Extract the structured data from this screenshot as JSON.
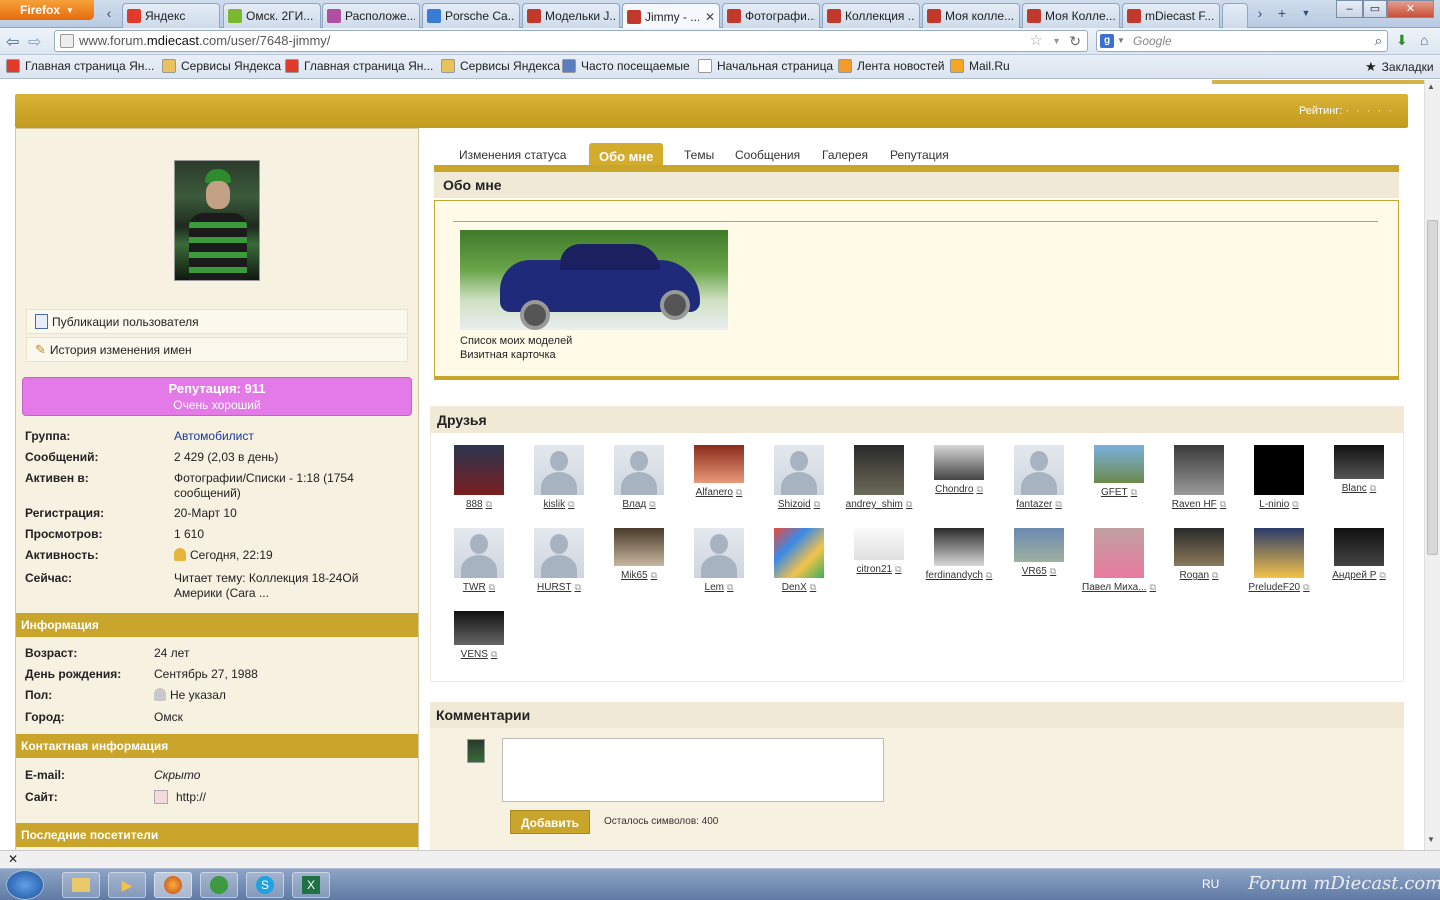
{
  "browser": {
    "menu_button": "Firefox",
    "tabs": [
      {
        "label": "Яндекс",
        "color": "#e23a2a"
      },
      {
        "label": "Омск. 2ГИ...",
        "color": "#7ab82f"
      },
      {
        "label": "Расположе...",
        "color": "#b04fa1"
      },
      {
        "label": "Porsche Ca...",
        "color": "#3a7bd5"
      },
      {
        "label": "Модельки J...",
        "color": "#c0392b"
      },
      {
        "label": "Jimmy - ...",
        "color": "#c0392b"
      },
      {
        "label": "Фотографи...",
        "color": "#c0392b"
      },
      {
        "label": "Коллекция ...",
        "color": "#c0392b"
      },
      {
        "label": "Моя колле...",
        "color": "#c0392b"
      },
      {
        "label": "Моя Колле...",
        "color": "#c0392b"
      },
      {
        "label": "mDiecast F...",
        "color": "#c0392b"
      }
    ],
    "active_tab_close": "✕",
    "url_prefix": "www.forum.",
    "url_domain": "mdiecast",
    "url_suffix": ".com/user/7648-jimmy/",
    "search_placeholder": "Google",
    "bookmarks": [
      {
        "label": "Главная страница Ян...",
        "icon": "yandex-icon"
      },
      {
        "label": "Сервисы Яндекса",
        "icon": "folder-icon"
      },
      {
        "label": "Главная страница Ян...",
        "icon": "yandex-icon"
      },
      {
        "label": "Сервисы Яндекса",
        "icon": "folder-icon"
      },
      {
        "label": "Часто посещаемые",
        "icon": "smart-folder-icon"
      },
      {
        "label": "Начальная страница",
        "icon": "page-icon"
      },
      {
        "label": "Лента новостей",
        "icon": "rss-icon"
      },
      {
        "label": "Mail.Ru",
        "icon": "mailru-icon"
      }
    ],
    "bookmarks_menu": "Закладки"
  },
  "header": {
    "rating_label": "Рейтинг:",
    "rating_stars": "· · · · ·"
  },
  "profile": {
    "links": {
      "publications": "Публикации пользователя",
      "name_history": "История изменения имен"
    },
    "reputation": {
      "title": "Репутация: 911",
      "subtitle": "Очень хороший"
    },
    "stats": [
      {
        "label": "Группа:",
        "value": "Автомобилист"
      },
      {
        "label": "Сообщений:",
        "value": "2 429 (2,03 в день)"
      },
      {
        "label": "Активен в:",
        "value": "Фотографии/Списки - 1:18 (1754 сообщений)"
      },
      {
        "label": "Регистрация:",
        "value": "20-Март 10"
      },
      {
        "label": "Просмотров:",
        "value": "1 610"
      },
      {
        "label": "Активность:",
        "value": "Сегодня, 22:19"
      },
      {
        "label": "Сейчас:",
        "value": "Читает тему: Коллекция 18-24Ой Америки (Cara ..."
      }
    ],
    "info_title": "Информация",
    "info": [
      {
        "label": "Возраст:",
        "value": "24 лет"
      },
      {
        "label": "День рождения:",
        "value": "Сентябрь 27, 1988"
      },
      {
        "label": "Пол:",
        "value": "Не указал"
      },
      {
        "label": "Город:",
        "value": "Омск"
      }
    ],
    "contact_title": "Контактная информация",
    "contact": [
      {
        "label": "E-mail:",
        "value": "Скрыто"
      },
      {
        "label": "Сайт:",
        "value": "http://"
      }
    ],
    "visitors_title": "Последние посетители"
  },
  "tabs": [
    {
      "label": "Изменения статуса"
    },
    {
      "label": "Обо мне"
    },
    {
      "label": "Темы"
    },
    {
      "label": "Сообщения"
    },
    {
      "label": "Галерея"
    },
    {
      "label": "Репутация"
    }
  ],
  "about": {
    "title": "Обо мне",
    "link1": "Список моих моделей",
    "link2": "Визитная карточка"
  },
  "friends": {
    "title": "Друзья",
    "items": [
      "888",
      "kislik",
      "Влад",
      "Alfanero",
      "Shizoid",
      "andrey_shim",
      "Chondro",
      "fantazer",
      "GFET",
      "Raven HF",
      "L-ninio",
      "Blanc",
      "TWR",
      "HURST",
      "Mik65",
      "Lem",
      "DenX",
      "citron21",
      "ferdinandych",
      "VR65",
      "Павел Миха...",
      "Rogan",
      "PreludeF20",
      "Андрей Р",
      "VENS"
    ]
  },
  "comments": {
    "title": "Комментарии",
    "submit": "Добавить",
    "remaining": "Осталось символов: 400"
  },
  "taskbar": {
    "lang": "RU",
    "watermark": "Forum mDiecast.com"
  },
  "colors": {
    "gold": "#c9a52b",
    "reputation": "#e37ae8",
    "cream": "#f6f1e0"
  }
}
